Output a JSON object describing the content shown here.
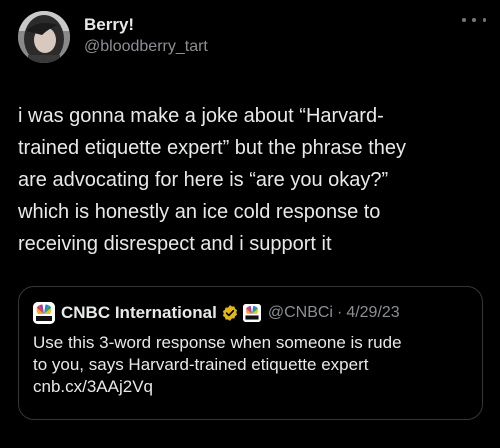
{
  "author": {
    "display_name": "Berry!",
    "handle": "@bloodberry_tart"
  },
  "tweet_text": "i was gonna make a joke about “Harvard-\ntrained etiquette expert” but the phrase they\nare advocating for here is “are you okay?”\nwhich is honestly an ice cold response to\nreceiving disrespect and i support it",
  "quoted_tweet": {
    "display_name": "CNBC International",
    "handle": "@CNBCi",
    "separator": "·",
    "date": "4/29/23",
    "text": "Use this 3-word response when someone is rude\nto you, says Harvard-trained etiquette expert\ncnb.cx/3AAj2Vq",
    "verified_badge_color": "#e2b719"
  },
  "icons": [
    "more-icon",
    "verified-gold-icon",
    "cnbc-logo",
    "cnbc-affiliate-badge"
  ],
  "colors": {
    "background": "#000000",
    "text": "#e7e9ea",
    "secondary_text": "#8b8f94",
    "border": "#333639"
  }
}
